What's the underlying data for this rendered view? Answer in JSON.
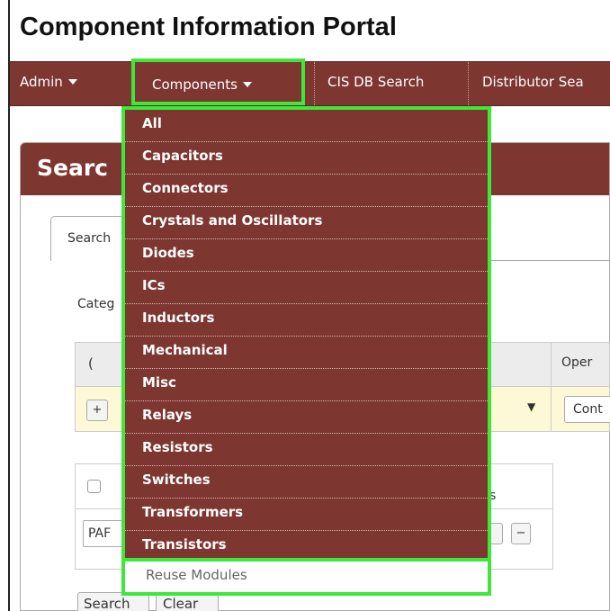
{
  "app": {
    "title": "Component Information Portal"
  },
  "nav": {
    "admin": "Admin",
    "components": "Components",
    "cis_search": "CIS DB Search",
    "distributor_search": "Distributor Sea"
  },
  "panel": {
    "title": "Searc"
  },
  "tabs": {
    "search": "Search"
  },
  "form": {
    "category_label": "Categ",
    "grid_header_paren": "(",
    "grid_header_operator": "Oper",
    "plus_label": "+",
    "dropdown_arrow": "▼",
    "operator_value": "Cont",
    "s_text": "s",
    "par_value": "PAF",
    "minus_label": "−"
  },
  "buttons": {
    "search": "Search",
    "clear": "Clear"
  },
  "menu": {
    "items": [
      "All",
      "Capacitors",
      "Connectors",
      "Crystals and Oscillators",
      "Diodes",
      "ICs",
      "Inductors",
      "Mechanical",
      "Misc",
      "Relays",
      "Resistors",
      "Switches",
      "Transformers",
      "Transistors"
    ],
    "reuse": "Reuse Modules"
  },
  "colors": {
    "brand": "#7e3630",
    "highlight": "#3ee83a",
    "row_highlight": "#fdf9d6"
  }
}
